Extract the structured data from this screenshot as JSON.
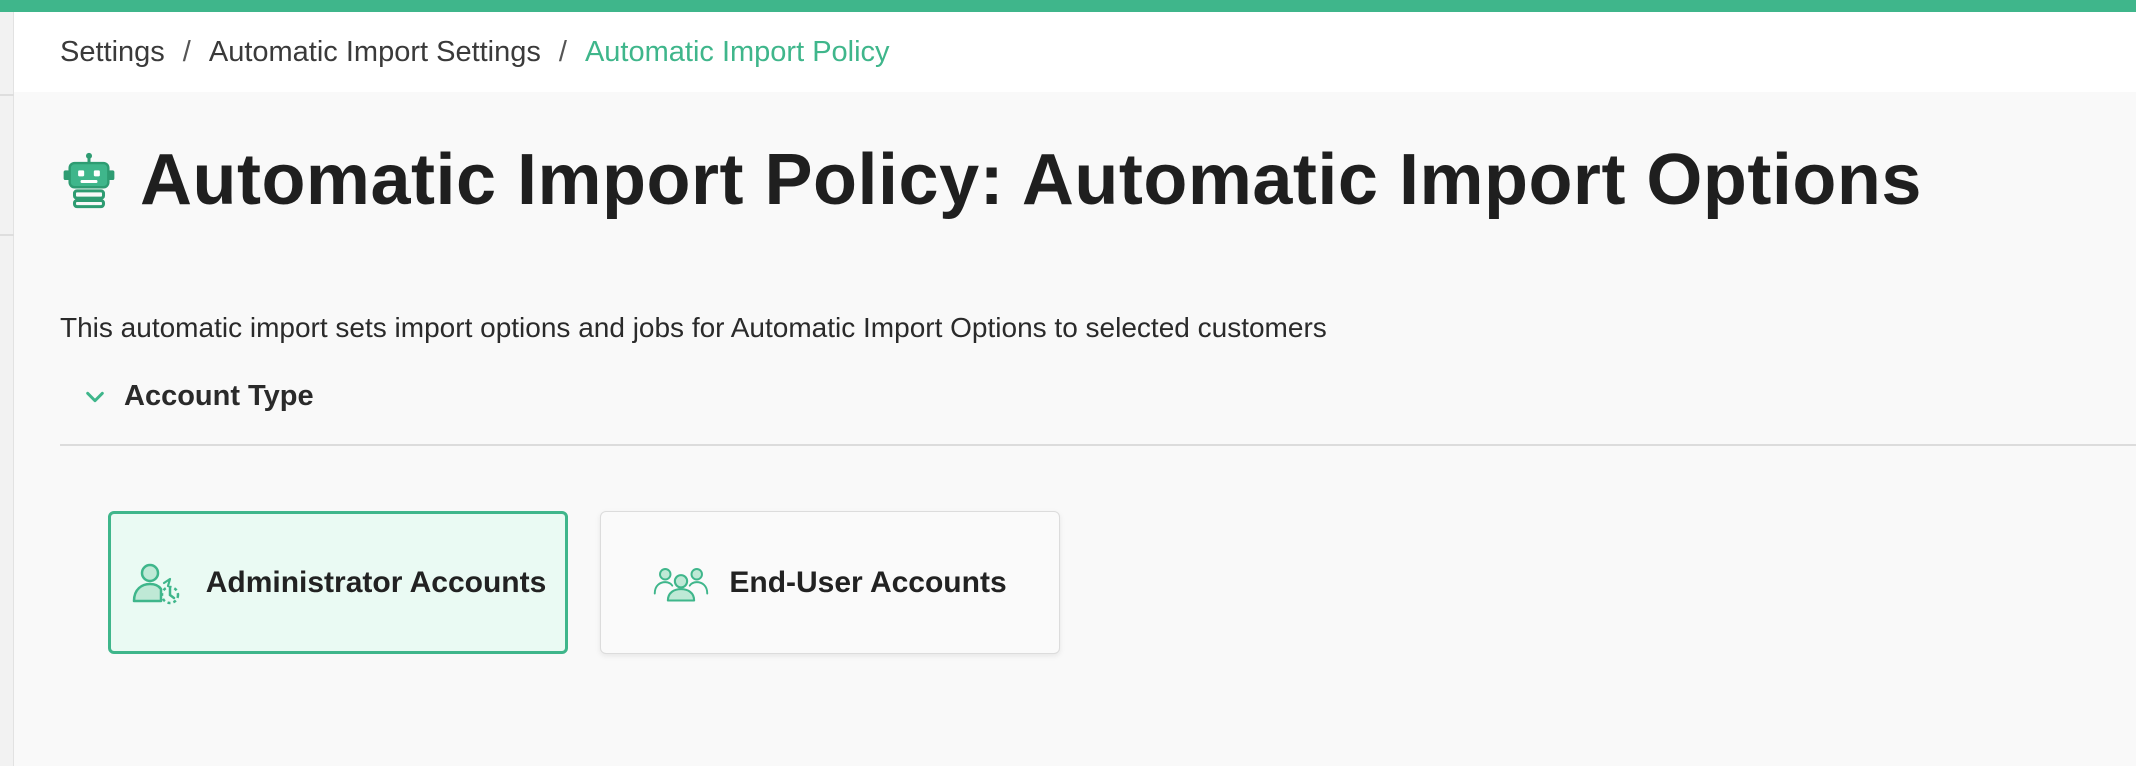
{
  "breadcrumb": {
    "items": [
      "Settings",
      "Automatic Import Settings"
    ],
    "separator": "/",
    "current": "Automatic Import Policy"
  },
  "header": {
    "icon": "robot-icon",
    "title": "Automatic Import Policy: Automatic Import Options"
  },
  "description": "This automatic import sets import options and jobs for Automatic Import Options to selected customers",
  "section": {
    "label": "Account Type",
    "expanded": true
  },
  "account_options": [
    {
      "label": "Administrator Accounts",
      "icon": "admin-user-icon",
      "selected": true
    },
    {
      "label": "End-User Accounts",
      "icon": "users-group-icon",
      "selected": false
    }
  ],
  "colors": {
    "accent": "#3fb68b",
    "selected_bg": "#eafaf3"
  }
}
